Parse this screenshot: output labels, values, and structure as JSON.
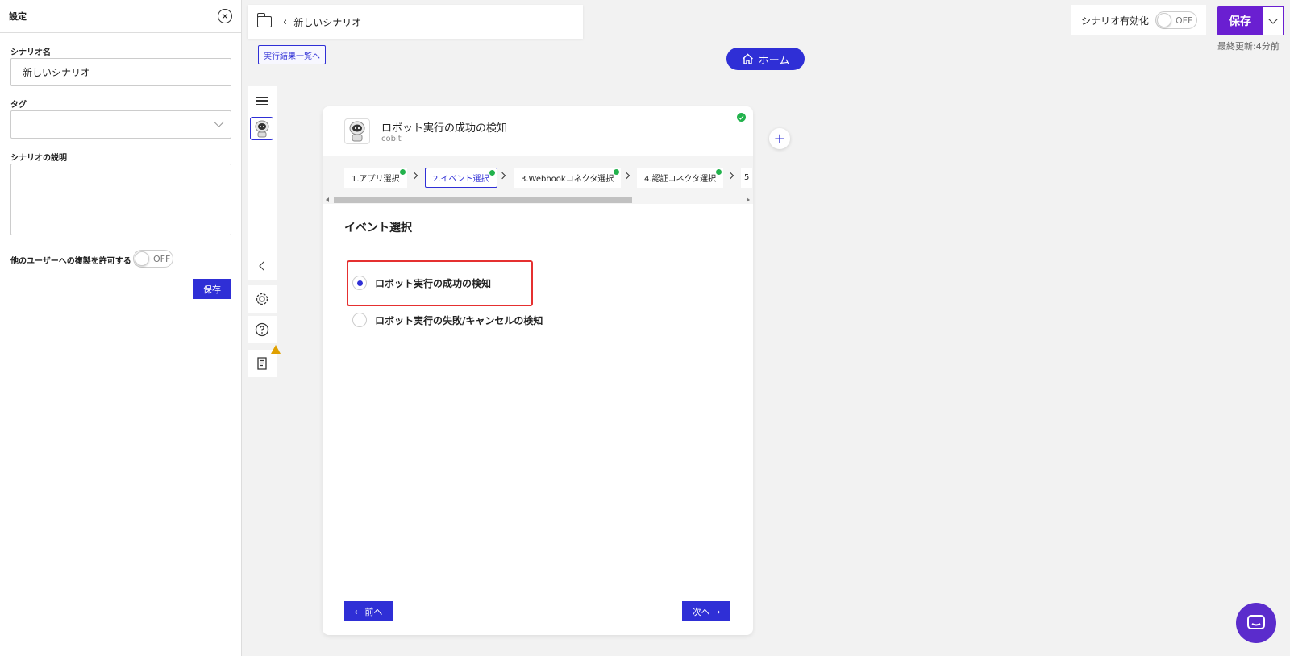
{
  "settings": {
    "title": "設定",
    "scenario_name_label": "シナリオ名",
    "scenario_name_value": "新しいシナリオ",
    "tag_label": "タグ",
    "description_label": "シナリオの説明",
    "allow_duplicate_label": "他のユーザーへの複製を許可する",
    "allow_duplicate_state": "OFF",
    "save_label": "保存"
  },
  "header": {
    "breadcrumb_title": "新しいシナリオ",
    "results_link": "実行結果一覧へ",
    "home_label": "ホーム",
    "enable_label": "シナリオ有効化",
    "enable_state": "OFF",
    "save_label": "保存",
    "last_updated": "最終更新:4分前"
  },
  "card": {
    "title": "ロボット実行の成功の検知",
    "subtitle": "cobit",
    "steps": [
      {
        "label": "1.アプリ選択",
        "done": true
      },
      {
        "label": "2.イベント選択",
        "done": true,
        "active": true
      },
      {
        "label": "3.Webhookコネクタ選択",
        "done": true
      },
      {
        "label": "4.認証コネクタ選択",
        "done": true
      },
      {
        "label": "5",
        "done": false
      }
    ],
    "section_title": "イベント選択",
    "options": [
      {
        "label": "ロボット実行の成功の検知",
        "selected": true
      },
      {
        "label": "ロボット実行の失敗/キャンセルの検知",
        "selected": false
      }
    ],
    "prev_label": "← 前へ",
    "next_label": "次へ →"
  },
  "colors": {
    "accent": "#2f2fd6",
    "save_purple": "#6a1fd1",
    "success": "#22b24c",
    "highlight": "#e53030",
    "warning": "#e0a000"
  }
}
